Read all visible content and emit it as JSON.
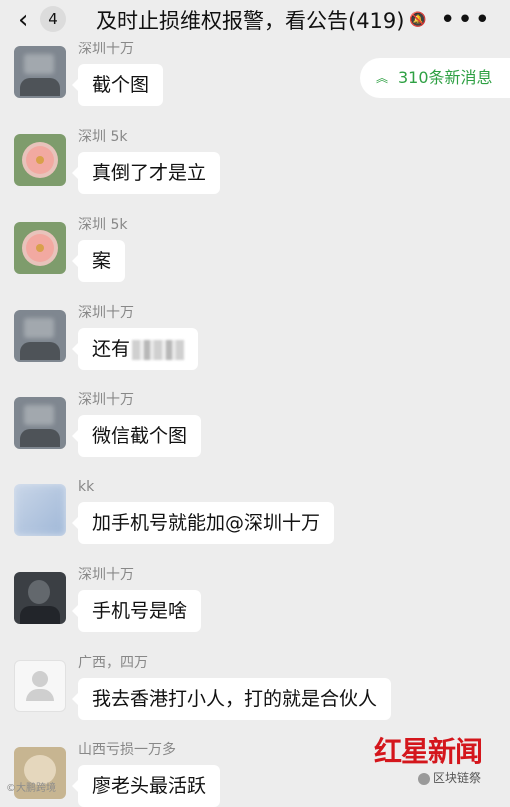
{
  "header": {
    "unread_count": "4",
    "title": "及时止损维权报警，看公告(419)",
    "more_label": "•••"
  },
  "new_messages": {
    "label": "310条新消息"
  },
  "messages": [
    {
      "sender": "深圳十万",
      "text": "截个图",
      "avatar": "gray-blurred-avatar"
    },
    {
      "sender": "深圳 5k",
      "text": "真倒了才是立",
      "avatar": "flower-avatar"
    },
    {
      "sender": "深圳 5k",
      "text": "案",
      "avatar": "flower-avatar"
    },
    {
      "sender": "深圳十万",
      "text": "还有",
      "avatar": "gray-blurred-avatar"
    },
    {
      "sender": "深圳十万",
      "text": "微信截个图",
      "avatar": "gray-blurred-avatar"
    },
    {
      "sender": "kk",
      "text": "加手机号就能加@深圳十万",
      "avatar": "blue-blurred-avatar"
    },
    {
      "sender": "深圳十万",
      "text": "手机号是啥",
      "avatar": "dark-blurred-avatar"
    },
    {
      "sender": "广西，四万",
      "text": "我去香港打小人，打的就是合伙人",
      "avatar": "default-person-avatar"
    },
    {
      "sender": "山西亏损一万多",
      "text": "廖老头最活跃",
      "avatar": "brown-blurred-avatar"
    }
  ],
  "watermarks": {
    "logo_text": "红星新闻",
    "channel_text": "区块链祭",
    "left_text": "©大鹏跨境"
  }
}
